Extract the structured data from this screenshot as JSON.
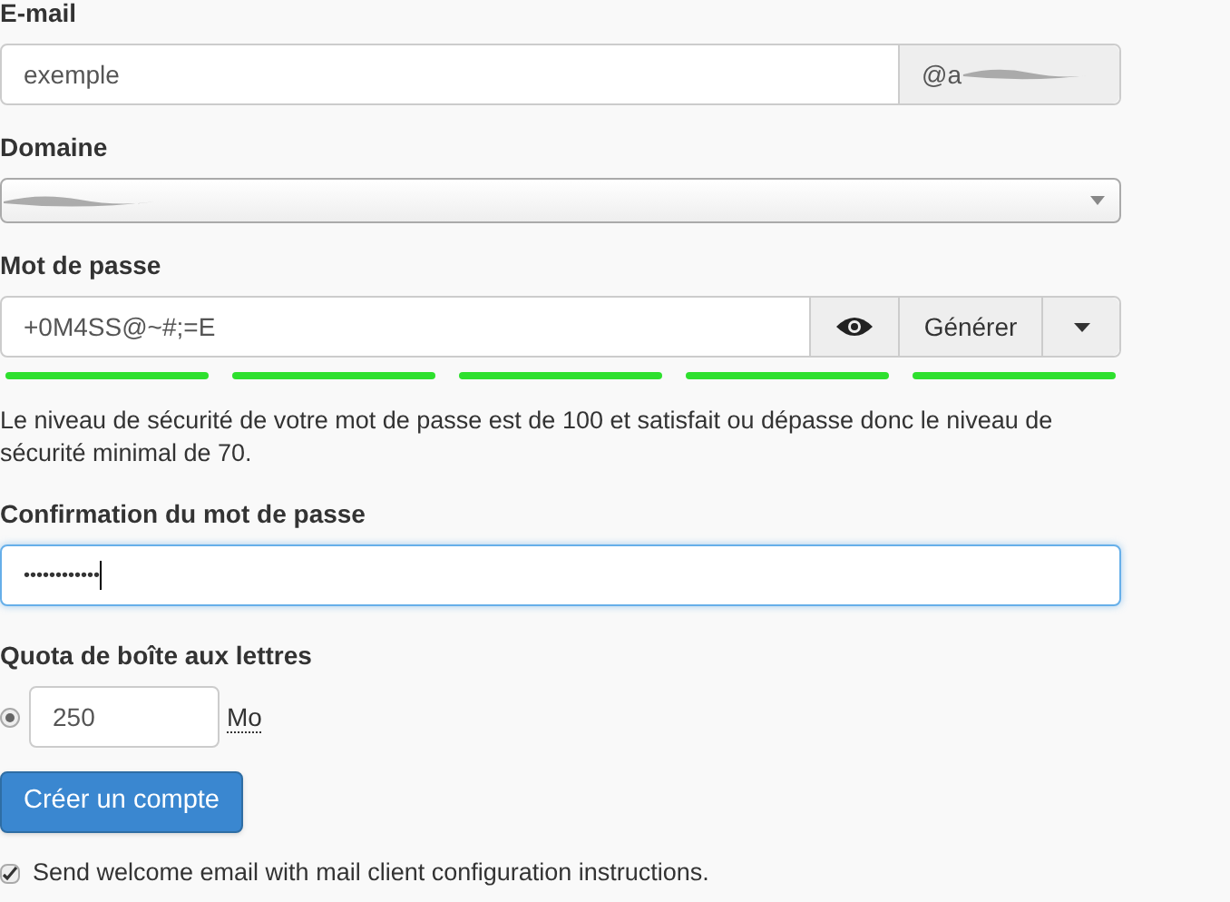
{
  "email": {
    "label": "E-mail",
    "value": "exemple",
    "suffix": "@a"
  },
  "domain": {
    "label": "Domaine"
  },
  "password": {
    "label": "Mot de passe",
    "value": "+0M4SS@~#;=E",
    "generate": "Générer",
    "strength": [
      {
        "on": true
      },
      {
        "on": true
      },
      {
        "on": true
      },
      {
        "on": true
      },
      {
        "on": true
      }
    ],
    "message": "Le niveau de sécurité de votre mot de passe est de 100 et satisfait ou dépasse donc le niveau de sécurité minimal de 70."
  },
  "confirm": {
    "label": "Confirmation du mot de passe",
    "value": "••••••••••••",
    "focused": true
  },
  "quota": {
    "label": "Quota de boîte aux lettres",
    "selected": true,
    "value": "250",
    "unit": "Mo"
  },
  "submit": "Créer un compte",
  "welcome": {
    "checked": true,
    "label": "Send welcome email with mail client configuration instructions."
  }
}
